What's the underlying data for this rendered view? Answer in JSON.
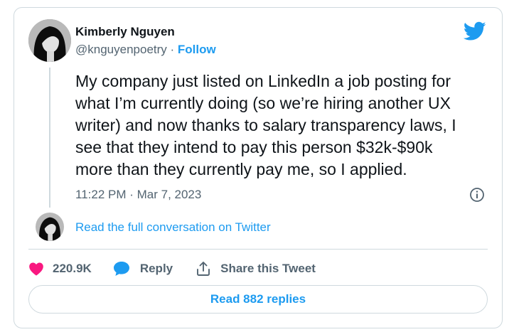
{
  "author": {
    "name": "Kimberly Nguyen",
    "handle": "@knguyenpoetry",
    "separator": " · ",
    "follow_label": "Follow"
  },
  "tweet": {
    "text": "My company just listed on LinkedIn a job posting for\nwhat I’m currently doing (so we’re hiring another UX\nwriter) and now thanks to salary transparency laws, I\nsee that they intend to pay this person $32k-$90k\nmore than they currently pay me, so I applied.",
    "timestamp": "11:22 PM · Mar 7, 2023"
  },
  "conversation": {
    "link_label": "Read the full conversation on Twitter"
  },
  "actions": {
    "like_count": "220.9K",
    "reply_label": "Reply",
    "share_label": "Share this Tweet"
  },
  "footer": {
    "read_replies_label": "Read 882 replies"
  },
  "icons": {
    "brand": "twitter-bird-icon",
    "info": "info-icon",
    "like": "heart-icon",
    "reply": "speech-bubble-icon",
    "share": "share-upload-icon"
  },
  "colors": {
    "accent": "#1d9bf0",
    "like": "#f91880",
    "text": "#0f1419",
    "secondary": "#536471",
    "border": "#cfd9de"
  }
}
